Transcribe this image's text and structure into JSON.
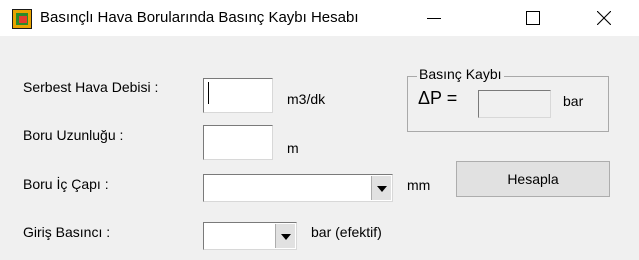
{
  "window": {
    "title": "Basınçlı Hava Borularında Basınç Kaybı Hesabı"
  },
  "form": {
    "free_air_flow": {
      "label": "Serbest Hava Debisi :",
      "value": "",
      "unit": "m3/dk"
    },
    "pipe_length": {
      "label": "Boru Uzunluğu :",
      "value": "",
      "unit": "m"
    },
    "pipe_inner_diameter": {
      "label": "Boru İç Çapı :",
      "selected": "",
      "unit": "mm"
    },
    "inlet_pressure": {
      "label": "Giriş Basıncı :",
      "selected": "",
      "unit": "bar (efektif)"
    }
  },
  "result": {
    "group_title": "Basınç Kaybı",
    "symbol": "ΔP =",
    "value": "",
    "unit": "bar"
  },
  "actions": {
    "calculate_label": "Hesapla"
  },
  "icons": {
    "app": "app-icon",
    "minimize": "minimize-icon",
    "maximize": "maximize-icon",
    "close": "close-icon",
    "dropdown": "chevron-down-icon"
  }
}
